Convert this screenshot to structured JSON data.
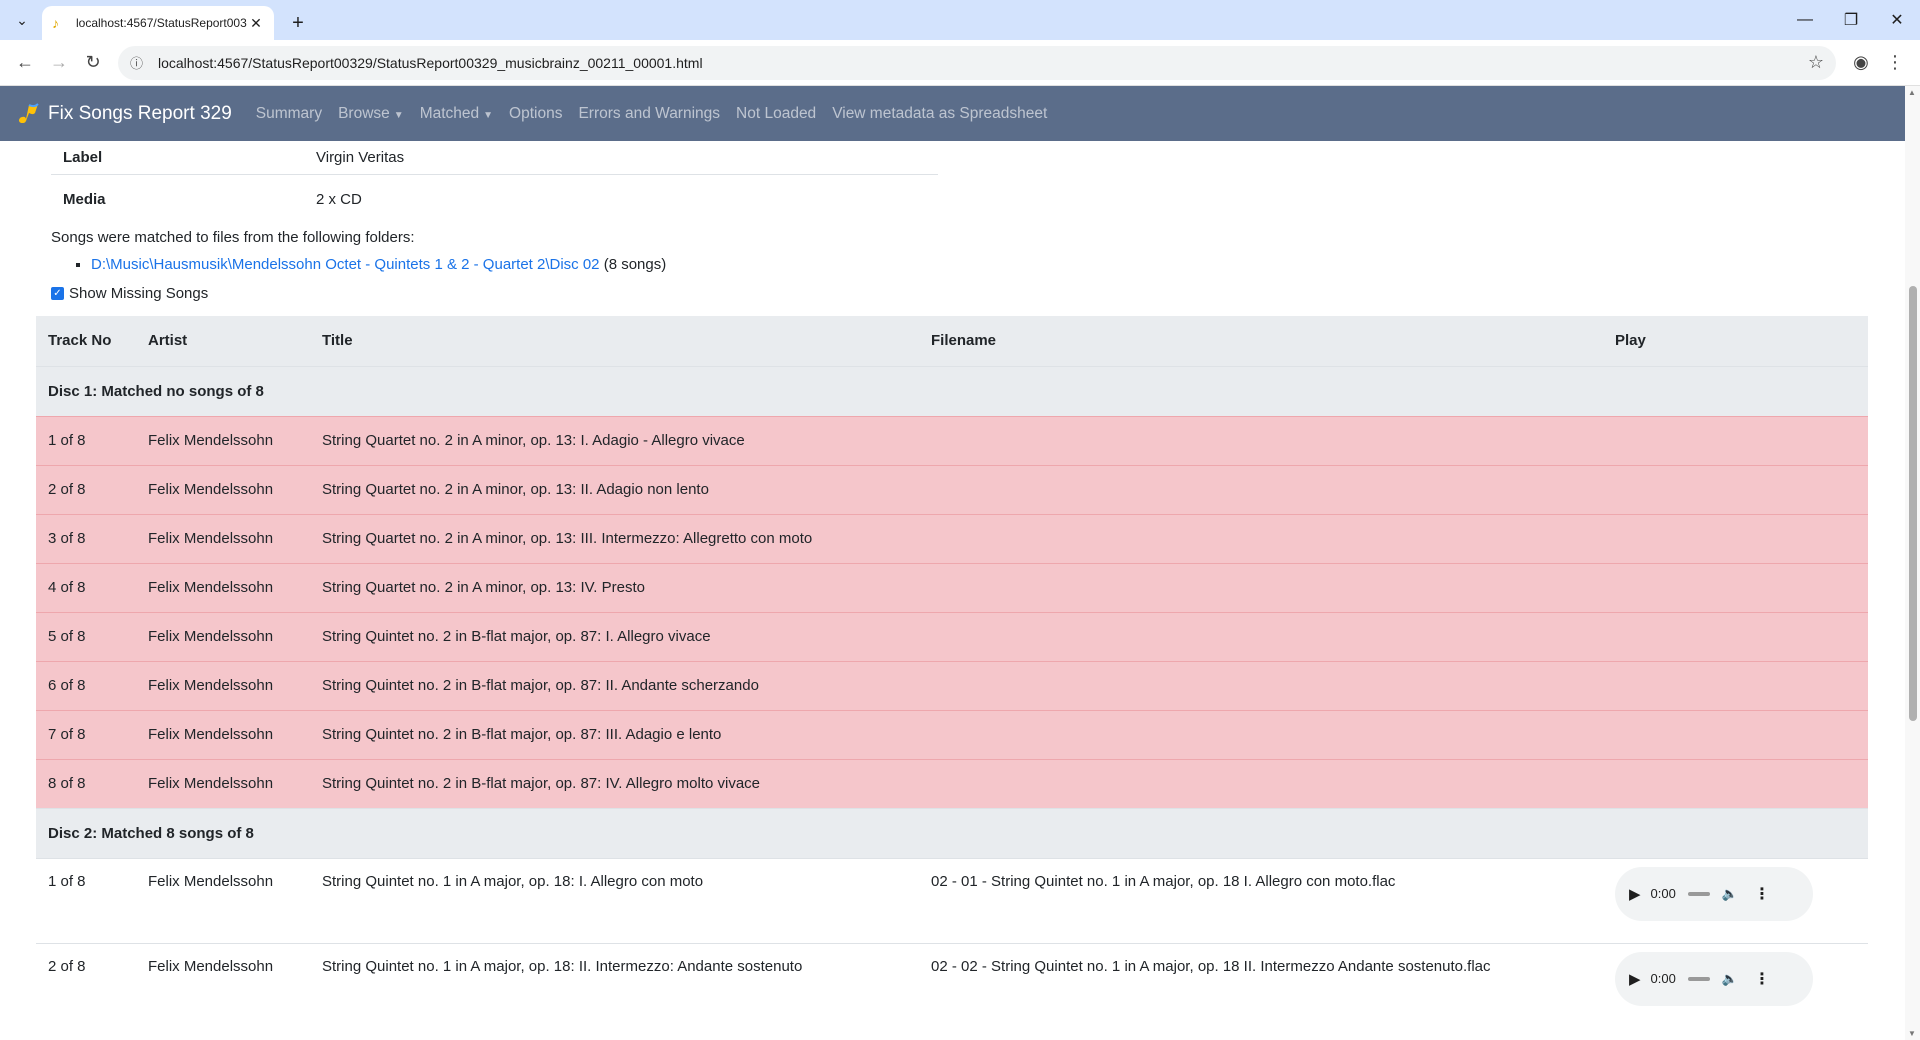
{
  "browser": {
    "tab_title": "localhost:4567/StatusReport003",
    "url": "localhost:4567/StatusReport00329/StatusReport00329_musicbrainz_00211_00001.html"
  },
  "navbar": {
    "brand": "Fix Songs Report 329",
    "links": {
      "summary": "Summary",
      "browse": "Browse",
      "matched": "Matched",
      "options": "Options",
      "errors": "Errors and Warnings",
      "not_loaded": "Not Loaded",
      "spreadsheet": "View metadata as Spreadsheet"
    }
  },
  "details": [
    {
      "key": "Label",
      "value": "Virgin Veritas"
    },
    {
      "key": "Media",
      "value": "2 x CD"
    }
  ],
  "folders": {
    "intro": "Songs were matched to files from the following folders:",
    "items": [
      {
        "path": "D:\\Music\\Hausmusik\\Mendelssohn Octet - Quintets 1 & 2 - Quartet 2\\Disc 02",
        "count": "(8 songs)"
      }
    ]
  },
  "show_missing_label": "Show Missing Songs",
  "table": {
    "headers": {
      "track": "Track No",
      "artist": "Artist",
      "title": "Title",
      "file": "Filename",
      "play": "Play"
    },
    "disc1": {
      "header": "Disc 1: Matched no songs of 8",
      "rows": [
        {
          "track": "1 of 8",
          "artist": "Felix Mendelssohn",
          "title": "String Quartet no. 2 in A minor, op. 13: I. Adagio - Allegro vivace"
        },
        {
          "track": "2 of 8",
          "artist": "Felix Mendelssohn",
          "title": "String Quartet no. 2 in A minor, op. 13: II. Adagio non lento"
        },
        {
          "track": "3 of 8",
          "artist": "Felix Mendelssohn",
          "title": "String Quartet no. 2 in A minor, op. 13: III. Intermezzo: Allegretto con moto"
        },
        {
          "track": "4 of 8",
          "artist": "Felix Mendelssohn",
          "title": "String Quartet no. 2 in A minor, op. 13: IV. Presto"
        },
        {
          "track": "5 of 8",
          "artist": "Felix Mendelssohn",
          "title": "String Quintet no. 2 in B-flat major, op. 87: I. Allegro vivace"
        },
        {
          "track": "6 of 8",
          "artist": "Felix Mendelssohn",
          "title": "String Quintet no. 2 in B-flat major, op. 87: II. Andante scherzando"
        },
        {
          "track": "7 of 8",
          "artist": "Felix Mendelssohn",
          "title": "String Quintet no. 2 in B-flat major, op. 87: III. Adagio e lento"
        },
        {
          "track": "8 of 8",
          "artist": "Felix Mendelssohn",
          "title": "String Quintet no. 2 in B-flat major, op. 87: IV. Allegro molto vivace"
        }
      ]
    },
    "disc2": {
      "header": "Disc 2: Matched 8 songs of 8",
      "rows": [
        {
          "track": "1 of 8",
          "artist": "Felix Mendelssohn",
          "title": "String Quintet no. 1 in A major, op. 18: I. Allegro con moto",
          "file": "02 - 01 - String Quintet no. 1 in A major, op. 18 I. Allegro con moto.flac",
          "time": "0:00"
        },
        {
          "track": "2 of 8",
          "artist": "Felix Mendelssohn",
          "title": "String Quintet no. 1 in A major, op. 18: II. Intermezzo: Andante sostenuto",
          "file": "02 - 02 - String Quintet no. 1 in A major, op. 18 II. Intermezzo Andante sostenuto.flac",
          "time": "0:00"
        }
      ]
    }
  }
}
